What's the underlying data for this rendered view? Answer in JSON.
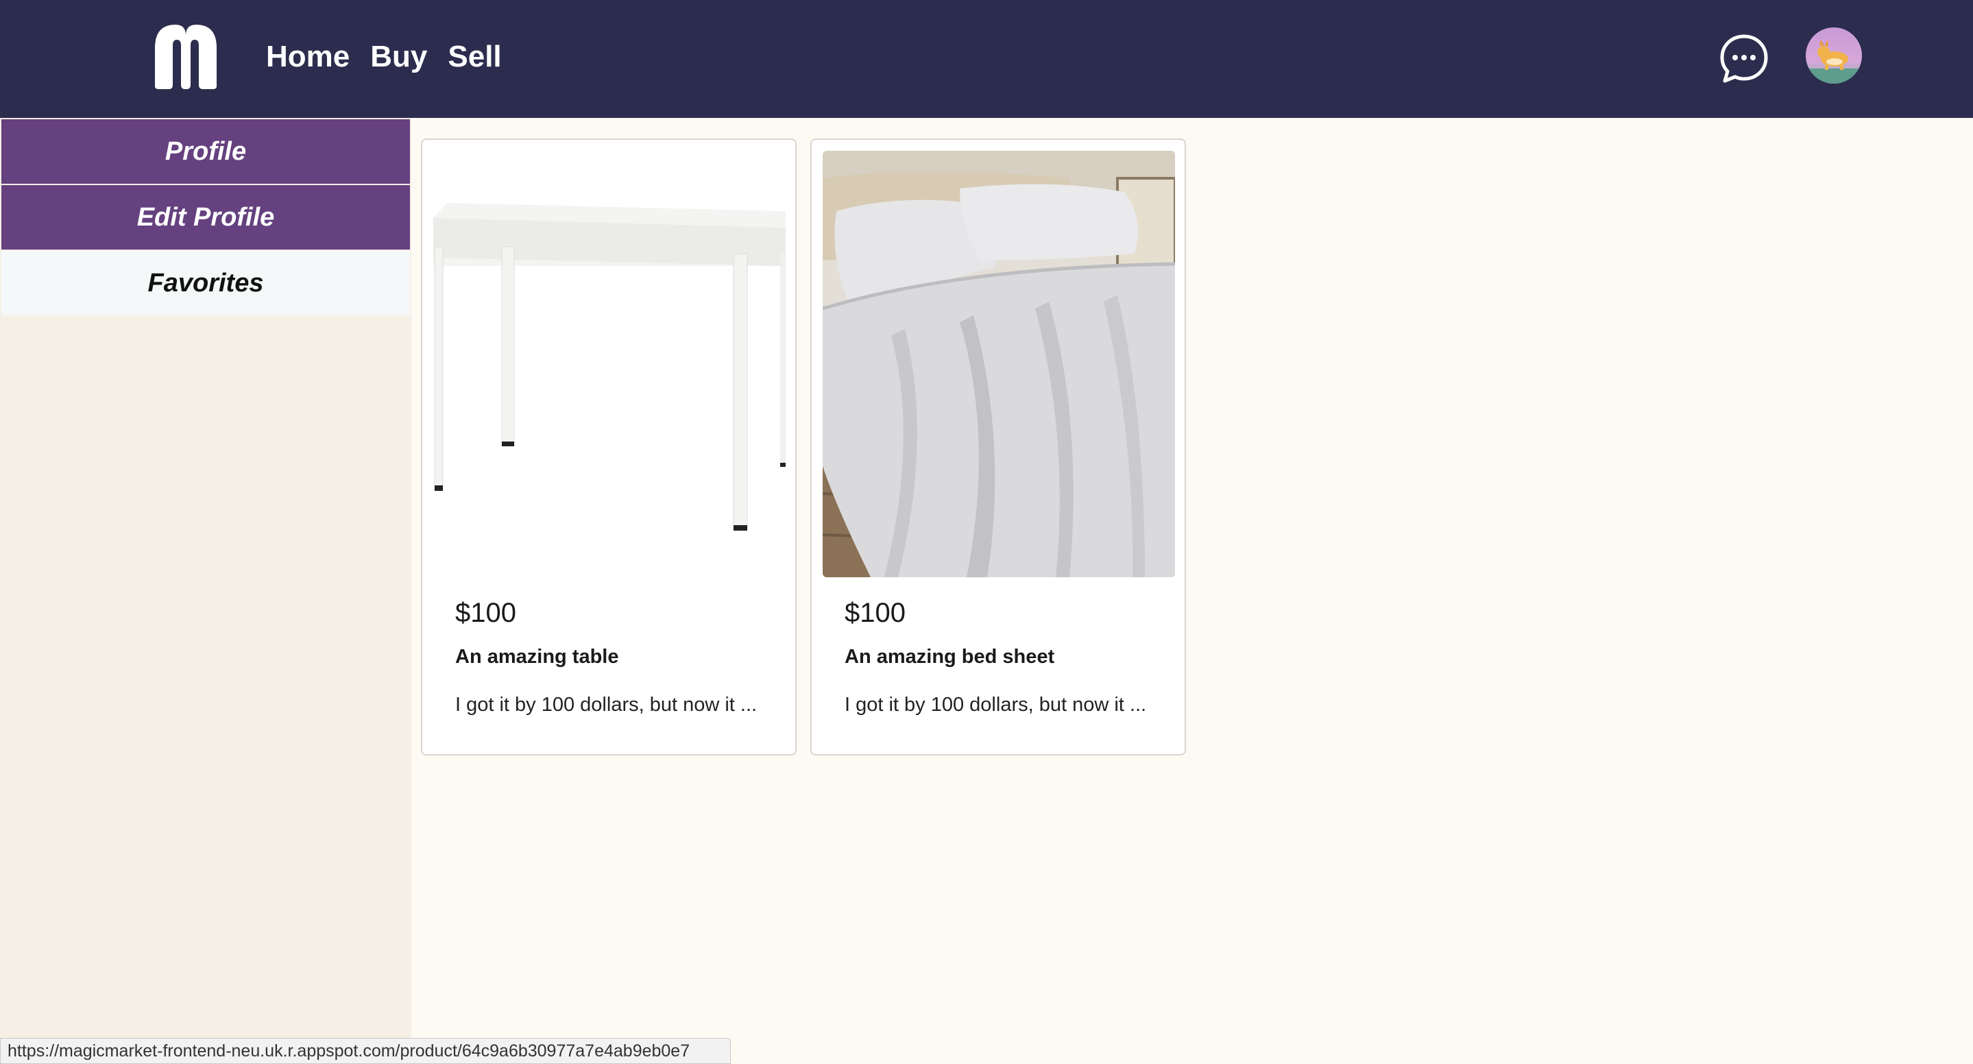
{
  "header": {
    "logo_letter": "m",
    "nav": [
      {
        "label": "Home"
      },
      {
        "label": "Buy"
      },
      {
        "label": "Sell"
      }
    ],
    "chat_icon": "chat-bubble-icon",
    "avatar_icon": "corgi-avatar"
  },
  "sidebar": {
    "items": [
      {
        "label": "Profile"
      },
      {
        "label": "Edit Profile"
      },
      {
        "label": "Favorites"
      }
    ]
  },
  "products": [
    {
      "price": "$100",
      "title": "An amazing table",
      "description": "I got it by 100 dollars, but now it ...",
      "image": "white-table"
    },
    {
      "price": "$100",
      "title": "An amazing bed sheet",
      "description": "I got it by 100 dollars, but now it ...",
      "image": "bed-sheet"
    }
  ],
  "status_url": "https://magicmarket-frontend-neu.uk.r.appspot.com/product/64c9a6b30977a7e4ab9eb0e7",
  "colors": {
    "topbar": "#2c2d4e",
    "sidebar_active": "#65417f",
    "sidebar_bg": "#f6efe6",
    "page_bg": "#fdf9f3"
  }
}
